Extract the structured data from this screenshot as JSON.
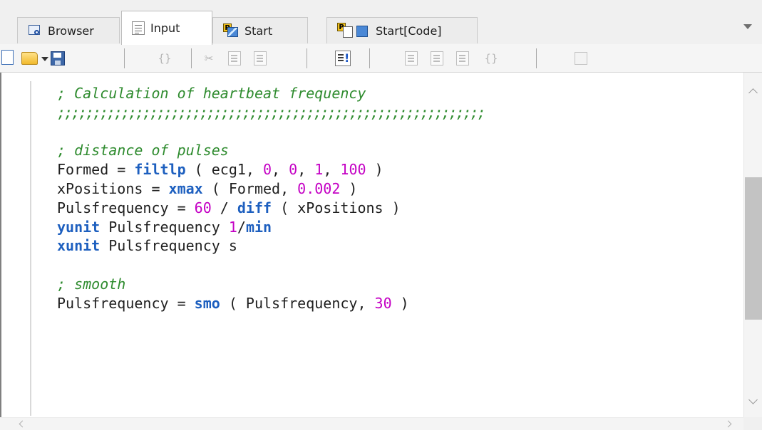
{
  "tabs": [
    {
      "label": "Browser",
      "icon": "browser-icon",
      "active": false
    },
    {
      "label": "Input",
      "icon": "input-icon",
      "active": true
    },
    {
      "label": "Start",
      "icon": "start-icon",
      "active": false
    },
    {
      "label": "Start[Code]",
      "icon": "start-code-icon",
      "active": false
    }
  ],
  "toolbar": {
    "items": [
      "new-document-icon",
      "open-folder-icon",
      "save-icon",
      "braces-icon",
      "cut-icon",
      "copy-icon",
      "paste-icon",
      "run-icon",
      "step-icon",
      "step-into-icon",
      "step-out-icon",
      "braces-step-icon",
      "edit-icon"
    ]
  },
  "editor": {
    "lines": [
      {
        "segments": [
          {
            "cls": "cm",
            "text": "; Calculation of heartbeat frequency"
          }
        ]
      },
      {
        "segments": [
          {
            "cls": "semi",
            "text": ";;;;;;;;;;;;;;;;;;;;;;;;;;;;;;;;;;;;;;;;;;;;;;;;;;;;;;;;;;;;"
          }
        ]
      },
      {
        "segments": []
      },
      {
        "segments": [
          {
            "cls": "cm",
            "text": "; distance of pulses"
          }
        ]
      },
      {
        "segments": [
          {
            "cls": "",
            "text": "Formed = "
          },
          {
            "cls": "kw",
            "text": "filtlp"
          },
          {
            "cls": "",
            "text": " ( ecg1, "
          },
          {
            "cls": "num",
            "text": "0"
          },
          {
            "cls": "",
            "text": ", "
          },
          {
            "cls": "num",
            "text": "0"
          },
          {
            "cls": "",
            "text": ", "
          },
          {
            "cls": "num",
            "text": "1"
          },
          {
            "cls": "",
            "text": ", "
          },
          {
            "cls": "num",
            "text": "100"
          },
          {
            "cls": "",
            "text": " )"
          }
        ]
      },
      {
        "segments": [
          {
            "cls": "",
            "text": "xPositions = "
          },
          {
            "cls": "kw",
            "text": "xmax"
          },
          {
            "cls": "",
            "text": " ( Formed, "
          },
          {
            "cls": "num",
            "text": "0.002"
          },
          {
            "cls": "",
            "text": " )"
          }
        ]
      },
      {
        "segments": [
          {
            "cls": "",
            "text": "Pulsfrequency = "
          },
          {
            "cls": "num",
            "text": "60"
          },
          {
            "cls": "",
            "text": " / "
          },
          {
            "cls": "kw",
            "text": "diff"
          },
          {
            "cls": "",
            "text": " ( xPositions )"
          }
        ]
      },
      {
        "segments": [
          {
            "cls": "kw",
            "text": "yunit"
          },
          {
            "cls": "",
            "text": " Pulsfrequency "
          },
          {
            "cls": "num",
            "text": "1"
          },
          {
            "cls": "",
            "text": "/"
          },
          {
            "cls": "kw",
            "text": "min"
          }
        ]
      },
      {
        "segments": [
          {
            "cls": "kw",
            "text": "xunit"
          },
          {
            "cls": "",
            "text": " Pulsfrequency s"
          }
        ]
      },
      {
        "segments": []
      },
      {
        "segments": [
          {
            "cls": "cm",
            "text": "; smooth"
          }
        ]
      },
      {
        "segments": [
          {
            "cls": "",
            "text": "Pulsfrequency = "
          },
          {
            "cls": "kw",
            "text": "smo"
          },
          {
            "cls": "",
            "text": " ( Pulsfrequency, "
          },
          {
            "cls": "num",
            "text": "30"
          },
          {
            "cls": "",
            "text": " )"
          }
        ]
      }
    ]
  },
  "colors": {
    "comment": "#2e8b2e",
    "keyword": "#1d5fbf",
    "number": "#c400c4",
    "text": "#1f1f1f"
  }
}
